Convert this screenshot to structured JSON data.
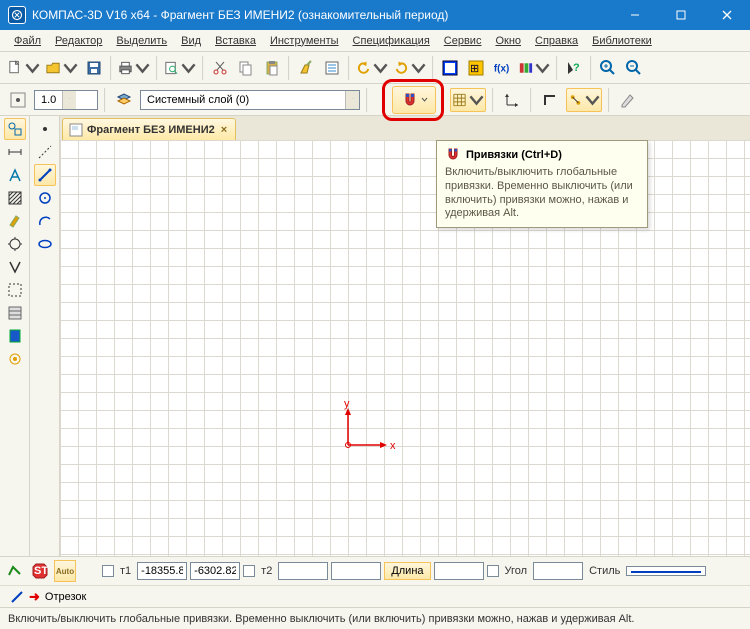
{
  "title": "КОМПАС-3D V16  x64 - Фрагмент БЕЗ ИМЕНИ2 (ознакомительный период)",
  "menu": [
    "Файл",
    "Редактор",
    "Выделить",
    "Вид",
    "Вставка",
    "Инструменты",
    "Спецификация",
    "Сервис",
    "Окно",
    "Справка",
    "Библиотеки"
  ],
  "toolbar2": {
    "scale": "1.0",
    "layer": "Системный слой (0)"
  },
  "tooltip": {
    "title": "Привязки (Ctrl+D)",
    "body": "Включить/выключить глобальные привязки. Временно выключить (или включить) привязки можно, нажав и удерживая Alt."
  },
  "doc_tab": "Фрагмент БЕЗ ИМЕНИ2",
  "params": {
    "t1_label": "т1",
    "x1": "-18355.8",
    "y1": "-6302.82",
    "t2_label": "т2",
    "x2": "",
    "y2": "",
    "length_label": "Длина",
    "length": "",
    "angle_label": "Угол",
    "angle": "",
    "style_label": "Стиль",
    "auto_label": "Auto",
    "stop_label": "STOP"
  },
  "cmd": {
    "text": "Отрезок"
  },
  "status": "Включить/выключить глобальные привязки. Временно выключить (или включить) привязки можно, нажав и удерживая Alt.",
  "axis": {
    "x": "x",
    "y": "y"
  }
}
